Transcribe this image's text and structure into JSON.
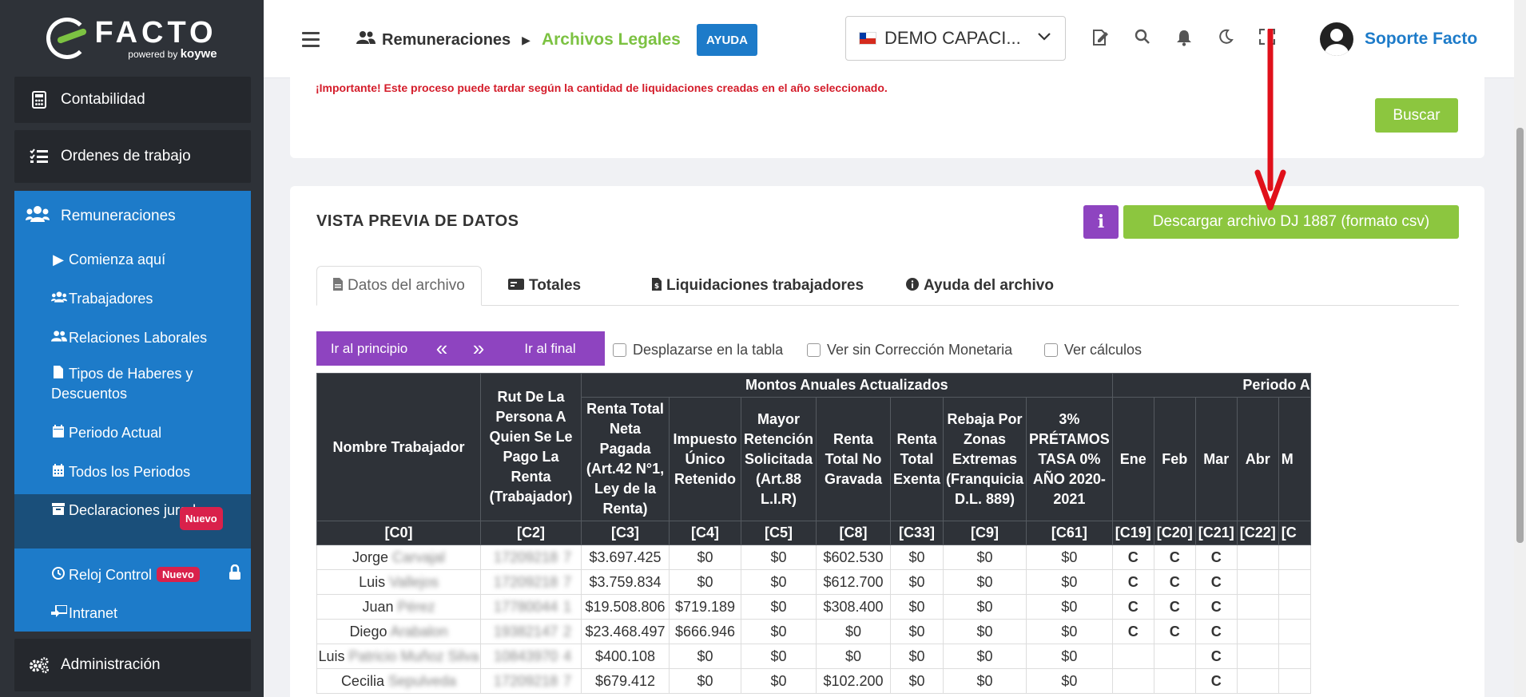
{
  "sidebar": {
    "logo_word": "FACTO",
    "logo_powered": "powered",
    "logo_by": "by",
    "logo_brand": "koywe",
    "items": [
      {
        "label": "Contabilidad"
      },
      {
        "label": "Ordenes de trabajo"
      },
      {
        "label": "Remuneraciones"
      },
      {
        "label": "Administración"
      }
    ],
    "sub_items": [
      {
        "label": "Comienza aquí"
      },
      {
        "label": "Trabajadores"
      },
      {
        "label": "Relaciones Laborales"
      },
      {
        "label": "Tipos de Haberes y Descuentos"
      },
      {
        "label": "Periodo Actual"
      },
      {
        "label": "Todos los Periodos"
      },
      {
        "label": "Declaraciones juradas",
        "badge": "Nuevo"
      },
      {
        "label": "Reloj Control",
        "badge": "Nuevo"
      },
      {
        "label": "Intranet"
      }
    ]
  },
  "header": {
    "breadcrumb_1": "Remuneraciones",
    "breadcrumb_2": "Archivos Legales",
    "help_button": "AYUDA",
    "company": "DEMO CAPACI...",
    "username": "Soporte Facto"
  },
  "search_card": {
    "warning": "¡Importante! Este proceso puede tardar según la cantidad de liquidaciones creadas en el año seleccionado.",
    "search_button": "Buscar"
  },
  "preview": {
    "title": "VISTA PREVIA DE DATOS",
    "info_button": "i",
    "download_button": "Descargar archivo DJ 1887 (formato csv)",
    "tabs": [
      {
        "label": "Datos del archivo"
      },
      {
        "label": "Totales"
      },
      {
        "label": "Liquidaciones trabajadores"
      },
      {
        "label": "Ayuda del archivo"
      }
    ],
    "nav": {
      "first": "Ir al principio",
      "prev": "«",
      "next": "»",
      "last": "Ir al final"
    },
    "checkboxes": [
      {
        "label": "Desplazarse en la tabla"
      },
      {
        "label": "Ver sin Corrección Monetaria"
      },
      {
        "label": "Ver cálculos"
      }
    ]
  },
  "table": {
    "group_montos": "Montos Anuales Actualizados",
    "group_periodo": "Periodo A",
    "headers": [
      "Nombre Trabajador",
      "Rut De La Persona A Quien Se Le Pago La Renta (Trabajador)",
      "Renta Total Neta Pagada (Art.42 N°1, Ley de la Renta)",
      "Impuesto Único Retenido",
      "Mayor Retención Solicitada (Art.88 L.I.R)",
      "Renta Total No Gravada",
      "Renta Total Exenta",
      "Rebaja Por Zonas Extremas (Franquicia D.L. 889)",
      "3% PRÉTAMOS TASA 0% AÑO 2020-2021",
      "Ene",
      "Feb",
      "Mar",
      "Abr",
      "M"
    ],
    "codes": [
      "[C0]",
      "[C2]",
      "[C3]",
      "[C4]",
      "[C5]",
      "[C8]",
      "[C33]",
      "[C9]",
      "[C61]",
      "[C19]",
      "[C20]",
      "[C21]",
      "[C22]",
      "[C"
    ],
    "rows": [
      {
        "first": "Jorge",
        "last": "Carvajal",
        "rut": "17209218",
        "dv": "7",
        "c3": "$3.697.425",
        "c4": "$0",
        "c5": "$0",
        "c8": "$602.530",
        "c33": "$0",
        "c9": "$0",
        "c61": "$0",
        "ene": "C",
        "feb": "C",
        "mar": "C"
      },
      {
        "first": "Luis",
        "last": "Vallejos",
        "rut": "17209218",
        "dv": "7",
        "c3": "$3.759.834",
        "c4": "$0",
        "c5": "$0",
        "c8": "$612.700",
        "c33": "$0",
        "c9": "$0",
        "c61": "$0",
        "ene": "C",
        "feb": "C",
        "mar": "C"
      },
      {
        "first": "Juan",
        "last": "Pérez",
        "rut": "17780044",
        "dv": "1",
        "c3": "$19.508.806",
        "c4": "$719.189",
        "c5": "$0",
        "c8": "$308.400",
        "c33": "$0",
        "c9": "$0",
        "c61": "$0",
        "ene": "C",
        "feb": "C",
        "mar": "C"
      },
      {
        "first": "Diego",
        "last": "Arabalon",
        "rut": "19382147",
        "dv": "2",
        "c3": "$23.468.497",
        "c4": "$666.946",
        "c5": "$0",
        "c8": "$0",
        "c33": "$0",
        "c9": "$0",
        "c61": "$0",
        "ene": "C",
        "feb": "C",
        "mar": "C"
      },
      {
        "first": "Luis",
        "last": "Patricio Muñoz Silva",
        "rut": "10843970",
        "dv": "4",
        "c3": "$400.108",
        "c4": "$0",
        "c5": "$0",
        "c8": "$0",
        "c33": "$0",
        "c9": "$0",
        "c61": "$0",
        "ene": "",
        "feb": "",
        "mar": "C"
      },
      {
        "first": "Cecilia",
        "last": "Sepulveda",
        "rut": "17209218",
        "dv": "7",
        "c3": "$679.412",
        "c4": "$0",
        "c5": "$0",
        "c8": "$102.200",
        "c33": "$0",
        "c9": "$0",
        "c61": "$0",
        "ene": "",
        "feb": "",
        "mar": "C"
      }
    ]
  },
  "colors": {
    "sidebar_bg": "#2e3238",
    "remu_blue": "#1d7bc9",
    "green": "#8cc63f",
    "purple": "#8e44c0",
    "warning_red": "#d41c2a",
    "arrow_red": "#e0101a"
  }
}
